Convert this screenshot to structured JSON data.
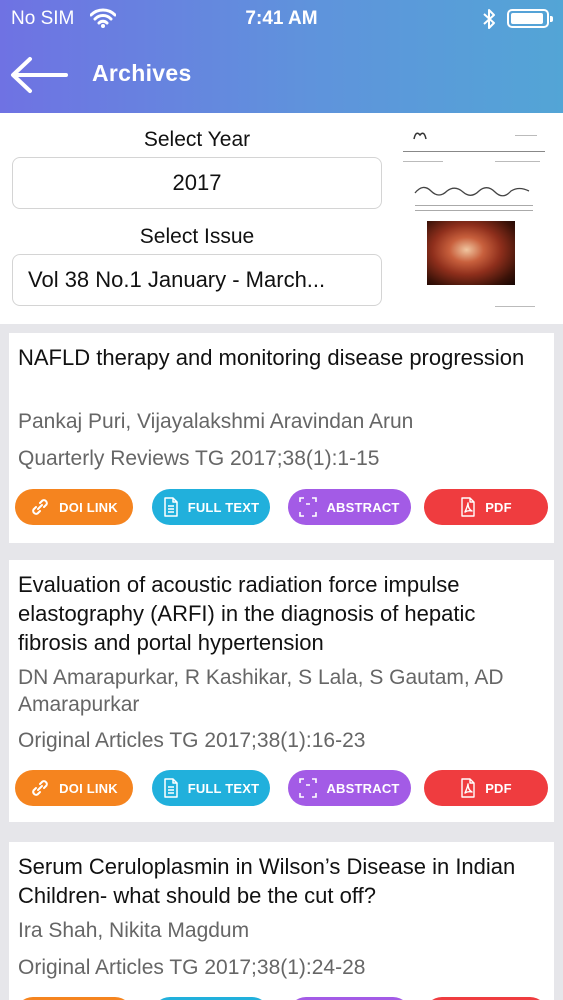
{
  "status_bar": {
    "carrier": "No SIM",
    "time": "7:41 AM"
  },
  "nav": {
    "title": "Archives",
    "back_icon": "back-arrow-icon"
  },
  "filters": {
    "year_label": "Select Year",
    "year_value": "2017",
    "issue_label": "Select Issue",
    "issue_value": "Vol 38 No.1 January - March..."
  },
  "actions": {
    "doi": "DOI LINK",
    "full_text": "FULL TEXT",
    "abstract": "ABSTRACT",
    "pdf": "PDF"
  },
  "colors": {
    "header_start": "#6f72e3",
    "header_end": "#53a5d6",
    "doi": "#f5841f",
    "full_text": "#21b0dc",
    "abstract": "#a35be6",
    "pdf": "#ef3c3f"
  },
  "articles": [
    {
      "title": "NAFLD therapy and monitoring disease progression",
      "authors": "Pankaj Puri, Vijayalakshmi Aravindan Arun",
      "reference": "Quarterly Reviews TG 2017;38(1):1-15"
    },
    {
      "title": "Evaluation of acoustic radiation force impulse elastography (ARFI) in the diagnosis of hepatic fibrosis and portal hypertension",
      "authors": "DN Amarapurkar, R Kashikar, S Lala, S Gautam, AD Amarapurkar",
      "reference": "Original Articles TG 2017;38(1):16-23"
    },
    {
      "title": "Serum Ceruloplasmin in Wilson’s Disease in Indian Children- what should be the cut off?",
      "authors": "Ira Shah, Nikita Magdum",
      "reference": "Original Articles TG 2017;38(1):24-28"
    }
  ]
}
